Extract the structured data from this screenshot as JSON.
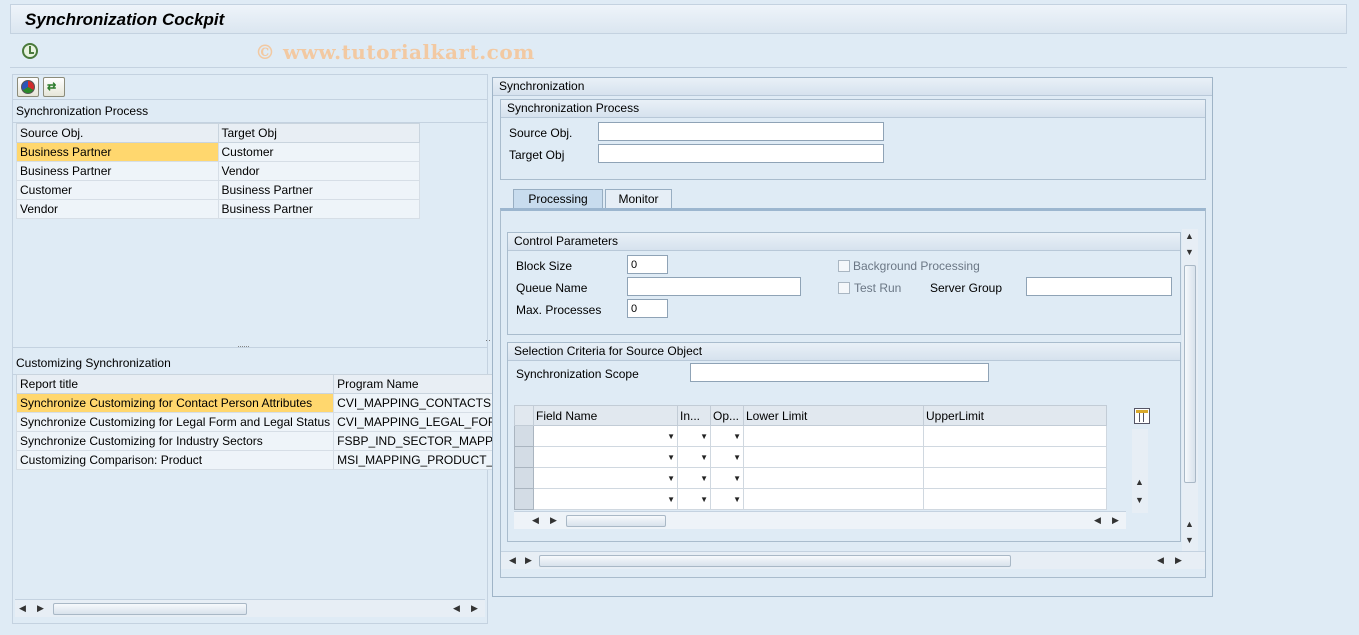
{
  "window": {
    "title": "Synchronization Cockpit",
    "watermark": "© www.tutorialkart.com"
  },
  "toolbar": {
    "execute_icon": "execute-icon"
  },
  "left": {
    "tool_icons": [
      "color-ball-icon",
      "refresh-arrows-icon"
    ],
    "sync_process": {
      "label": "Synchronization Process",
      "columns": [
        "Source Obj.",
        "Target Obj"
      ],
      "rows": [
        [
          "Business Partner",
          "Customer"
        ],
        [
          "Business Partner",
          "Vendor"
        ],
        [
          "Customer",
          "Business Partner"
        ],
        [
          "Vendor",
          "Business Partner"
        ]
      ],
      "selected_row": 0
    },
    "customizing": {
      "label": "Customizing Synchronization",
      "columns": [
        "Report title",
        "Program Name"
      ],
      "rows": [
        [
          "Synchronize Customizing for Contact Person Attributes",
          "CVI_MAPPING_CONTACTS"
        ],
        [
          "Synchronize Customizing for Legal Form and Legal Status",
          "CVI_MAPPING_LEGAL_FOR"
        ],
        [
          "Synchronize Customizing for Industry Sectors",
          "FSBP_IND_SECTOR_MAPPI"
        ],
        [
          "Customizing Comparison: Product",
          "MSI_MAPPING_PRODUCT_"
        ]
      ],
      "selected_row": 0
    }
  },
  "right": {
    "title": "Synchronization",
    "process_box": {
      "title": "Synchronization Process",
      "source_label": "Source Obj.",
      "source_value": "",
      "target_label": "Target Obj",
      "target_value": ""
    },
    "tabs": [
      {
        "label": "Processing",
        "active": true
      },
      {
        "label": "Monitor",
        "active": false
      }
    ],
    "control": {
      "title": "Control Parameters",
      "block_size_label": "Block Size",
      "block_size_value": "0",
      "queue_name_label": "Queue Name",
      "queue_name_value": "",
      "max_proc_label": "Max. Processes",
      "max_proc_value": "0",
      "background_label": "Background Processing",
      "background_checked": false,
      "test_run_label": "Test Run",
      "test_run_checked": false,
      "server_group_label": "Server Group",
      "server_group_value": ""
    },
    "selection": {
      "title": "Selection Criteria for Source Object",
      "scope_label": "Synchronization Scope",
      "scope_value": "",
      "columns": [
        "Field Name",
        "In...",
        "Op...",
        "Lower Limit",
        "UpperLimit"
      ],
      "row_count": 4,
      "settings_icon": "table-settings-icon"
    }
  }
}
